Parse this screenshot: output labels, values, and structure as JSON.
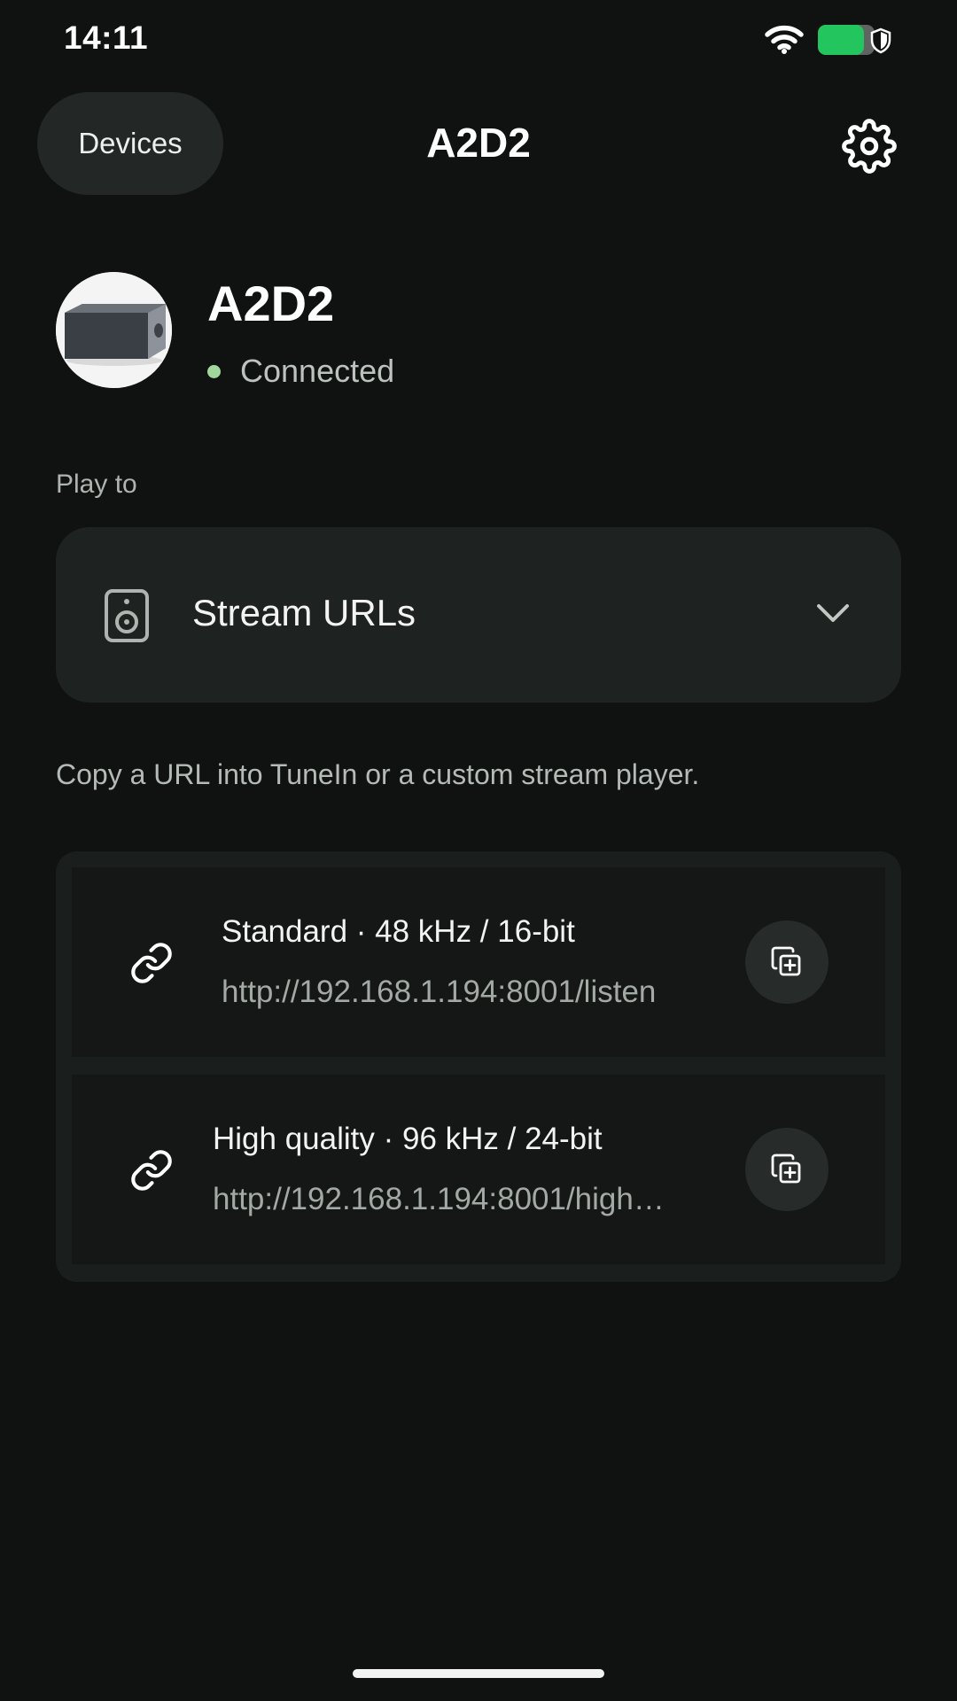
{
  "status_bar": {
    "time": "14:11",
    "battery_color": "#22c55e"
  },
  "header": {
    "back_label": "Devices",
    "title": "A2D2",
    "settings_icon": "gear-icon"
  },
  "device": {
    "name": "A2D2",
    "status": "Connected",
    "status_color": "#9fd79d"
  },
  "play_to": {
    "label": "Play to",
    "selected": "Stream URLs",
    "icon": "speaker-icon"
  },
  "helper_text": "Copy a URL into TuneIn or a custom stream player.",
  "streams": [
    {
      "title": "Standard · 48 kHz / 16-bit",
      "url": "http://192.168.1.194:8001/listen"
    },
    {
      "title": "High quality · 96 kHz / 24-bit",
      "url": "http://192.168.1.194:8001/high…"
    }
  ]
}
